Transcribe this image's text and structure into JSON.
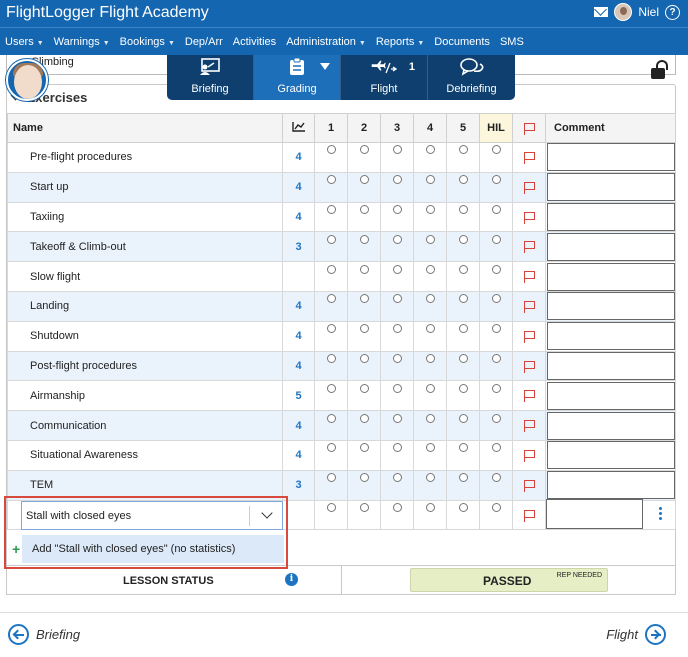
{
  "app": {
    "title": "FlightLogger Flight Academy",
    "user_name": "Niel",
    "help_label": "?"
  },
  "nav": {
    "items": [
      {
        "label": "Users",
        "dropdown": true
      },
      {
        "label": "Warnings",
        "dropdown": true
      },
      {
        "label": "Bookings",
        "dropdown": true
      },
      {
        "label": "Dep/Arr",
        "dropdown": false
      },
      {
        "label": "Activities",
        "dropdown": false
      },
      {
        "label": "Administration",
        "dropdown": true
      },
      {
        "label": "Reports",
        "dropdown": true
      },
      {
        "label": "Documents",
        "dropdown": false
      },
      {
        "label": "SMS",
        "dropdown": false
      }
    ]
  },
  "steps": [
    {
      "label": "Briefing",
      "icon": "briefing-icon",
      "count": "",
      "active": false
    },
    {
      "label": "Grading",
      "icon": "clipboard-icon",
      "count": "",
      "active": true
    },
    {
      "label": "Flight",
      "icon": "plane-icon",
      "count": "1",
      "active": false
    },
    {
      "label": "Debriefing",
      "icon": "chat-icon",
      "count": "",
      "active": false
    }
  ],
  "previous_row": "Climbing",
  "section_title": "Exercises",
  "table": {
    "headers": {
      "name": "Name",
      "grades": [
        "1",
        "2",
        "3",
        "4",
        "5",
        "HIL"
      ],
      "comment": "Comment"
    },
    "rows": [
      {
        "name": "Pre-flight procedures",
        "stat": "4"
      },
      {
        "name": "Start up",
        "stat": "4"
      },
      {
        "name": "Taxiing",
        "stat": "4"
      },
      {
        "name": "Takeoff & Climb-out",
        "stat": "3"
      },
      {
        "name": "Slow flight",
        "stat": ""
      },
      {
        "name": "Landing",
        "stat": "4"
      },
      {
        "name": "Shutdown",
        "stat": "4"
      },
      {
        "name": "Post-flight procedures",
        "stat": "4"
      },
      {
        "name": "Airmanship",
        "stat": "5"
      },
      {
        "name": "Communication",
        "stat": "4"
      },
      {
        "name": "Situational Awareness",
        "stat": "4"
      },
      {
        "name": "TEM",
        "stat": "3"
      }
    ]
  },
  "new_exercise": {
    "value": "Stall with closed eyes",
    "option": "Add \"Stall with closed eyes\" (no statistics)"
  },
  "lesson_status": {
    "label": "LESSON STATUS",
    "result": "PASSED",
    "note": "REP NEEDED"
  },
  "footer": {
    "back": "Briefing",
    "forward": "Flight"
  },
  "colors": {
    "brand": "#1466b0",
    "accent": "#1d74c2",
    "flag": "#d9423a",
    "highlight": "#d84b3c"
  }
}
